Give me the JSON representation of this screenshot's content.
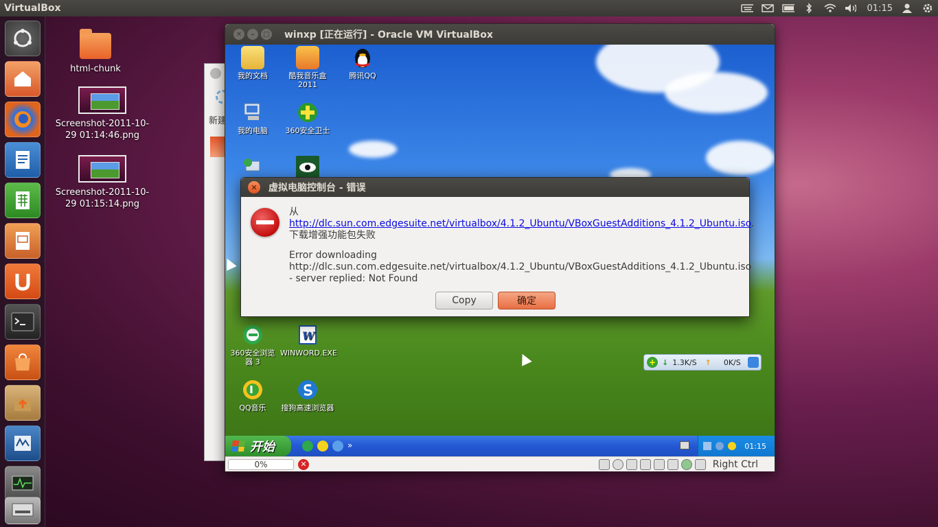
{
  "top_panel": {
    "app_title": "VirtualBox",
    "clock": "01:15"
  },
  "launcher": {
    "items": [
      {
        "name": "ubuntu-dash"
      },
      {
        "name": "home-folder"
      },
      {
        "name": "firefox"
      },
      {
        "name": "libreoffice-writer"
      },
      {
        "name": "libreoffice-calc"
      },
      {
        "name": "libreoffice-impress"
      },
      {
        "name": "ubuntu-one"
      },
      {
        "name": "terminal"
      },
      {
        "name": "software-center"
      },
      {
        "name": "update-manager"
      },
      {
        "name": "virtualbox"
      },
      {
        "name": "system-monitor"
      },
      {
        "name": "system-tool"
      }
    ]
  },
  "desktop": {
    "icons": [
      {
        "label": "html-chunk",
        "type": "folder"
      },
      {
        "label": "Screenshot-2011-10-29 01:14:46.png",
        "type": "image"
      },
      {
        "label": "Screenshot-2011-10-29 01:15:14.png",
        "type": "image"
      }
    ]
  },
  "vbox_window": {
    "title": "winxp [正在运行] - Oracle VM VirtualBox",
    "status": {
      "progress": "0%",
      "host_key": "Right Ctrl"
    }
  },
  "background_window": {
    "label": "新建"
  },
  "guest": {
    "icons": [
      {
        "label": "我的文档"
      },
      {
        "label": "酷我音乐盒2011"
      },
      {
        "label": "腾讯QQ"
      },
      {
        "label": "我的电脑"
      },
      {
        "label": "360安全卫士"
      },
      {
        "label": "360安全浏览器 3"
      },
      {
        "label": "WINWORD.EXE"
      },
      {
        "label": "QQ音乐"
      },
      {
        "label": "搜狗高速浏览器"
      }
    ],
    "speed_widget": {
      "down": "1.3K/S",
      "up": "0K/S"
    },
    "taskbar": {
      "start_label": "开始",
      "clock": "01:15"
    }
  },
  "dialog": {
    "title": "虚拟电脑控制台 - 错误",
    "line_from": "从",
    "url": "http://dlc.sun.com.edgesuite.net/virtualbox/4.1.2_Ubuntu/VBoxGuestAdditions_4.1.2_Ubuntu.iso",
    "url_suffix": ".",
    "line_fail": "下载增强功能包失败",
    "detail_1": "Error downloading",
    "detail_2": "http://dlc.sun.com.edgesuite.net/virtualbox/4.1.2_Ubuntu/VBoxGuestAdditions_4.1.2_Ubuntu.iso",
    "detail_3": "- server replied: Not Found",
    "copy_label": "Copy",
    "ok_label": "确定"
  }
}
